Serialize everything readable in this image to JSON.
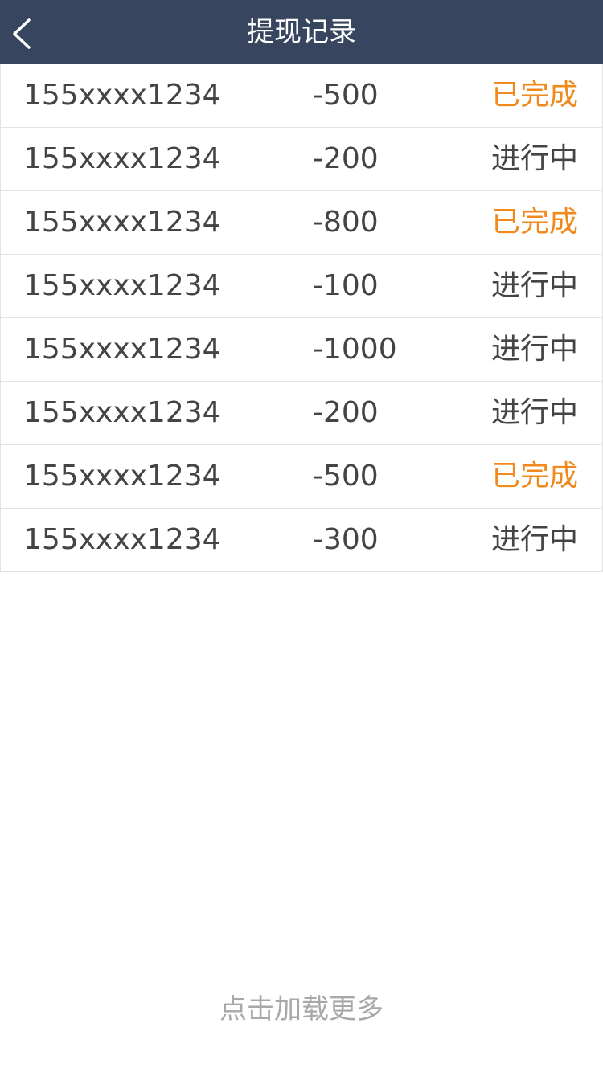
{
  "header": {
    "title": "提现记录",
    "back_icon": "chevron-left-icon",
    "background": "#37465e"
  },
  "records": [
    {
      "phone": "155xxxx1234",
      "amount": "-500",
      "status": "已完成",
      "state": "done"
    },
    {
      "phone": "155xxxx1234",
      "amount": "-200",
      "status": "进行中",
      "state": "pending"
    },
    {
      "phone": "155xxxx1234",
      "amount": "-800",
      "status": "已完成",
      "state": "done"
    },
    {
      "phone": "155xxxx1234",
      "amount": "-100",
      "status": "进行中",
      "state": "pending"
    },
    {
      "phone": "155xxxx1234",
      "amount": "-1000",
      "status": "进行中",
      "state": "pending"
    },
    {
      "phone": "155xxxx1234",
      "amount": "-200",
      "status": "进行中",
      "state": "pending"
    },
    {
      "phone": "155xxxx1234",
      "amount": "-500",
      "status": "已完成",
      "state": "done"
    },
    {
      "phone": "155xxxx1234",
      "amount": "-300",
      "status": "进行中",
      "state": "pending"
    }
  ],
  "colors": {
    "status_done": "#f08a1c",
    "status_pending": "#444444"
  },
  "footer": {
    "load_more_label": "点击加载更多"
  }
}
